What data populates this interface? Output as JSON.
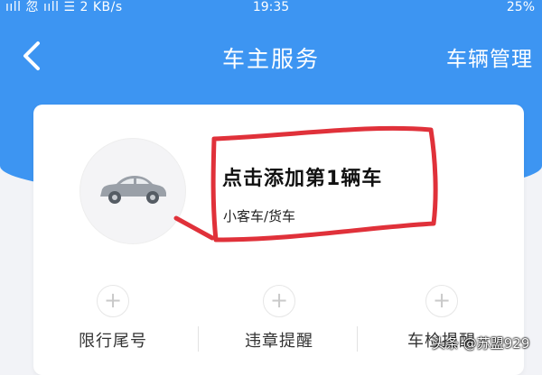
{
  "status_bar": {
    "left_text": "ııll 忽 ııll ☰ 2 KB/s",
    "time": "19:35",
    "battery": "25%"
  },
  "header": {
    "title": "车主服务",
    "right_action": "车辆管理",
    "back_icon": "chevron-left-icon"
  },
  "card": {
    "add_vehicle_title": "点击添加第1辆车",
    "vehicle_types": "小客车/货车",
    "car_icon": "car-icon",
    "functions": [
      {
        "label": "限行尾号",
        "icon": "plus-icon"
      },
      {
        "label": "违章提醒",
        "icon": "plus-icon"
      },
      {
        "label": "车检提醒",
        "icon": "plus-icon"
      }
    ]
  },
  "watermark": "头条 @苏盟929",
  "colors": {
    "primary_blue": "#3d95f2",
    "annotation_red": "#e0313a",
    "background": "#f2f3f7"
  }
}
